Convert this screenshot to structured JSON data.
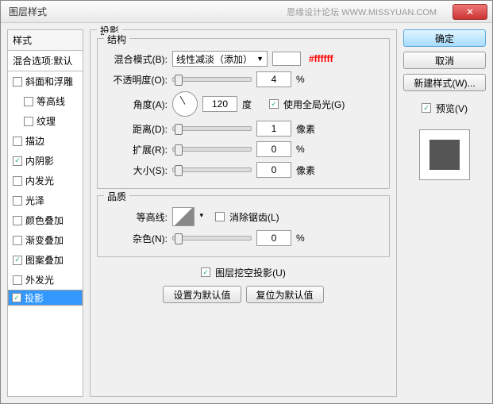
{
  "title": "图层样式",
  "watermark": "思缘设计论坛  WWW.MISSYUAN.COM",
  "left": {
    "head": "样式",
    "sub": "混合选项:默认",
    "items": [
      {
        "label": "斜面和浮雕",
        "checked": false,
        "indent": false
      },
      {
        "label": "等高线",
        "checked": false,
        "indent": true
      },
      {
        "label": "纹理",
        "checked": false,
        "indent": true
      },
      {
        "label": "描边",
        "checked": false,
        "indent": false
      },
      {
        "label": "内阴影",
        "checked": true,
        "indent": false
      },
      {
        "label": "内发光",
        "checked": false,
        "indent": false
      },
      {
        "label": "光泽",
        "checked": false,
        "indent": false
      },
      {
        "label": "颜色叠加",
        "checked": false,
        "indent": false
      },
      {
        "label": "渐变叠加",
        "checked": false,
        "indent": false
      },
      {
        "label": "图案叠加",
        "checked": true,
        "indent": false
      },
      {
        "label": "外发光",
        "checked": false,
        "indent": false
      },
      {
        "label": "投影",
        "checked": true,
        "indent": false,
        "selected": true
      }
    ]
  },
  "panel": {
    "title": "投影",
    "structure": {
      "title": "结构",
      "blend": {
        "label": "混合模式(B):",
        "value": "线性减淡（添加）",
        "hex": "#ffffff"
      },
      "opacity": {
        "label": "不透明度(O):",
        "value": "4",
        "unit": "%"
      },
      "angle": {
        "label": "角度(A):",
        "value": "120",
        "unit": "度",
        "global": "使用全局光(G)"
      },
      "distance": {
        "label": "距离(D):",
        "value": "1",
        "unit": "像素"
      },
      "spread": {
        "label": "扩展(R):",
        "value": "0",
        "unit": "%"
      },
      "size": {
        "label": "大小(S):",
        "value": "0",
        "unit": "像素"
      }
    },
    "quality": {
      "title": "品质",
      "contour": {
        "label": "等高线:",
        "anti": "消除锯齿(L)"
      },
      "noise": {
        "label": "杂色(N):",
        "value": "0",
        "unit": "%"
      }
    },
    "knockout": "图层挖空投影(U)",
    "defaults": {
      "set": "设置为默认值",
      "reset": "复位为默认值"
    }
  },
  "right": {
    "ok": "确定",
    "cancel": "取消",
    "new": "新建样式(W)...",
    "preview": "预览(V)"
  }
}
